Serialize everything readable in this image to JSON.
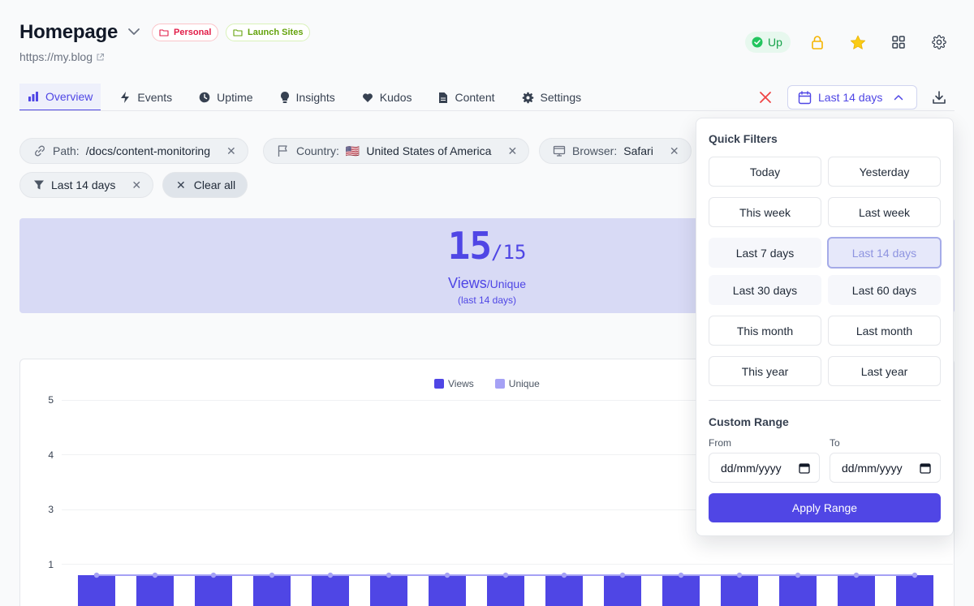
{
  "header": {
    "title": "Homepage",
    "url": "https://my.blog",
    "tags": [
      {
        "label": "Personal",
        "color": "#e11d48"
      },
      {
        "label": "Launch Sites",
        "color": "#65a30d"
      }
    ],
    "status": "Up"
  },
  "tabs": [
    {
      "label": "Overview",
      "icon": "bar-chart-icon",
      "active": true
    },
    {
      "label": "Events",
      "icon": "bolt-icon"
    },
    {
      "label": "Uptime",
      "icon": "clock-icon"
    },
    {
      "label": "Insights",
      "icon": "lightbulb-icon"
    },
    {
      "label": "Kudos",
      "icon": "heart-icon"
    },
    {
      "label": "Content",
      "icon": "document-icon"
    },
    {
      "label": "Settings",
      "icon": "gear-icon"
    }
  ],
  "range_button": {
    "label": "Last 14 days"
  },
  "filters": {
    "path": {
      "key": "Path:",
      "value": "/docs/content-monitoring"
    },
    "country": {
      "key": "Country:",
      "flag": "🇺🇸",
      "value": "United States of America"
    },
    "browser": {
      "key": "Browser:",
      "value": "Safari"
    },
    "range": {
      "value": "Last 14 days"
    },
    "clear_all": "Clear all"
  },
  "summary": {
    "views": "15",
    "separator": "/",
    "unique": "15",
    "views_label": "Views",
    "unique_label": "/Unique",
    "period": "(last 14 days)"
  },
  "chart_data": {
    "type": "bar",
    "series": [
      {
        "name": "Views",
        "values": [
          1,
          1,
          1,
          1,
          1,
          1,
          1,
          1,
          1,
          1,
          1,
          1,
          1,
          1,
          1
        ],
        "color": "#4f46e5"
      },
      {
        "name": "Unique",
        "values": [
          1,
          1,
          1,
          1,
          1,
          1,
          1,
          1,
          1,
          1,
          1,
          1,
          1,
          1,
          1
        ],
        "color": "#a5a1f5"
      }
    ],
    "yticks": [
      "5",
      "4",
      "3",
      "1"
    ],
    "grid": true,
    "legend": "top-center"
  },
  "dropdown": {
    "quick_title": "Quick Filters",
    "options": [
      "Today",
      "Yesterday",
      "This week",
      "Last week",
      "Last 7 days",
      "Last 14 days",
      "Last 30 days",
      "Last 60 days",
      "This month",
      "Last month",
      "This year",
      "Last year"
    ],
    "selected": "Last 14 days",
    "custom_title": "Custom Range",
    "from_label": "From",
    "to_label": "To",
    "from_placeholder": "dd/mm/yyyy",
    "to_placeholder": "dd/mm/yyyy",
    "apply_label": "Apply Range"
  }
}
